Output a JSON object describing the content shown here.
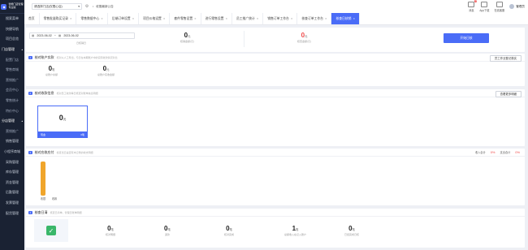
{
  "sidebar": {
    "logo_text": "智能门店管理\n专业版",
    "items": [
      {
        "label": "搜索菜单",
        "type": "item"
      },
      {
        "label": "快捷导航",
        "type": "item"
      },
      {
        "label": "项目总览",
        "type": "item"
      },
      {
        "label": "门店管理",
        "type": "group"
      },
      {
        "label": "配置门店",
        "type": "sub"
      },
      {
        "label": "零售商城",
        "type": "sub"
      },
      {
        "label": "营销推广",
        "type": "sub"
      },
      {
        "label": "会员中心",
        "type": "sub"
      },
      {
        "label": "零售统计",
        "type": "sub"
      },
      {
        "label": "特价中心",
        "type": "sub"
      },
      {
        "label": "分店管理",
        "type": "group"
      },
      {
        "label": "营销推广",
        "type": "sub"
      },
      {
        "label": "销售管理",
        "type": "item"
      },
      {
        "label": "小程序商城",
        "type": "item"
      },
      {
        "label": "采购管理",
        "type": "item"
      },
      {
        "label": "库存管理",
        "type": "item"
      },
      {
        "label": "资金管理",
        "type": "item"
      },
      {
        "label": "后勤管理",
        "type": "item"
      },
      {
        "label": "发票管理",
        "type": "item"
      },
      {
        "label": "配货管理",
        "type": "item"
      }
    ]
  },
  "topbar": {
    "store_select": "请选择门店(仅限心店)",
    "announcement": "收展最新公告",
    "right_items": [
      {
        "label": "消息",
        "badge": "9"
      },
      {
        "label": "App下载",
        "badge": ""
      },
      {
        "label": "在线客服",
        "badge": ""
      }
    ],
    "user_name": "管理员"
  },
  "tabs": [
    {
      "label": "首页",
      "active": false
    },
    {
      "label": "零售批量购买记录",
      "active": false
    },
    {
      "label": "零售数据中心",
      "active": false
    },
    {
      "label": "后端订单设置",
      "active": false
    },
    {
      "label": "项目价格设置",
      "active": false
    },
    {
      "label": "套件零售设置",
      "active": false
    },
    {
      "label": "进行零售设置",
      "active": false
    },
    {
      "label": "员工推广统计",
      "active": false
    },
    {
      "label": "销售订单工作台",
      "active": false
    },
    {
      "label": "核查订单工作台",
      "active": false
    },
    {
      "label": "核查日核销",
      "active": true
    }
  ],
  "summary": {
    "start_date": "2023-06-02",
    "separator": "~",
    "end_date": "2023-06-02",
    "date_caption": "日核销日",
    "stat1": {
      "value": "0",
      "unit": "元",
      "label": "核销金额(元)"
    },
    "stat2": {
      "value": "0",
      "unit": "元",
      "label": "核查金额(元)"
    },
    "button": "开始日核"
  },
  "section1": {
    "tag": "1",
    "title": "核对账户实款",
    "subtitle": "核对从人工导出，与日在本期账户中的实际收款情况对比",
    "button": "员工作业登记核实",
    "stats": [
      {
        "value": "0",
        "unit": "笔",
        "label": "总账户余额"
      },
      {
        "value": "0",
        "unit": "元",
        "label": "总账户实收金额"
      }
    ]
  },
  "section2": {
    "tag": "2",
    "title": "核对收款信息",
    "subtitle": "核对员工收款每日核查对账单信息明细",
    "button": "查看更多明细",
    "card": {
      "value": "0",
      "unit": "元",
      "footer_left": "现金",
      "footer_right": "0笔"
    }
  },
  "section3": {
    "tag": "3",
    "title": "核对应收应付",
    "subtitle": "检查当日是否有未记录的收支明细",
    "legend": [
      {
        "label": "收入合计",
        "value": "0%"
      },
      {
        "label": "支出合计",
        "value": "0%"
      }
    ],
    "bar_labels": [
      "收银",
      "收款"
    ]
  },
  "section4": {
    "tag": "4",
    "title": "核查日清",
    "subtitle": "核查日清单，管理日账单明细",
    "stats": [
      {
        "value": "0",
        "unit": "笔",
        "label": "核对明细"
      },
      {
        "value": "0",
        "unit": "笔",
        "label": "退款"
      },
      {
        "value": "0",
        "unit": "笔",
        "label": "核对完成"
      },
      {
        "value": "1",
        "unit": "笔",
        "label": "总额收入在记入账户"
      },
      {
        "value": "0",
        "unit": "笔",
        "label": "已经完成日核"
      }
    ]
  },
  "chart_data": {
    "type": "bar",
    "categories": [
      "收银",
      "收款"
    ],
    "values": [
      1,
      0
    ],
    "colors": [
      "#f0a52b",
      "#5b7cf5"
    ]
  },
  "colors": {
    "accent": "#4a6cf7",
    "sidebar_bg": "#1a2233",
    "warning": "#f04b4b",
    "bar": "#f0a52b"
  }
}
